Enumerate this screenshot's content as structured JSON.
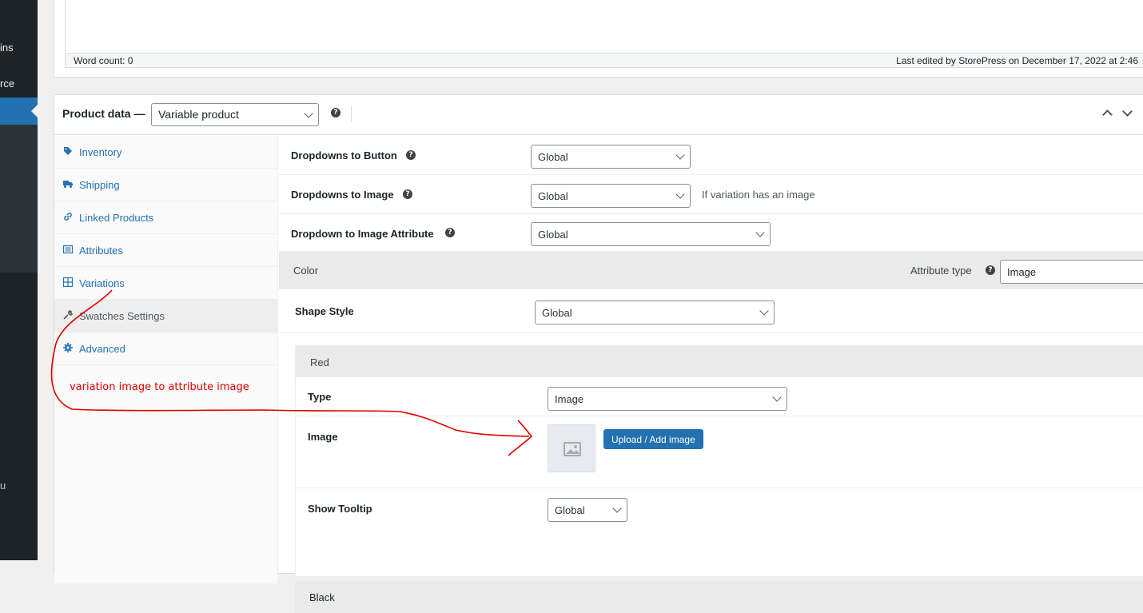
{
  "admin_menu": {
    "items": [
      "ins",
      "rce",
      "u"
    ]
  },
  "editor": {
    "word_count": "Word count: 0",
    "last_edited": "Last edited by StorePress on December 17, 2022 at 2:46"
  },
  "product_data": {
    "label": "Product data —",
    "type_value": "Variable product",
    "tabs": [
      {
        "label": "Inventory",
        "icon": "tag-icon"
      },
      {
        "label": "Shipping",
        "icon": "truck-icon"
      },
      {
        "label": "Linked Products",
        "icon": "link-icon"
      },
      {
        "label": "Attributes",
        "icon": "list-icon"
      },
      {
        "label": "Variations",
        "icon": "grid-icon"
      },
      {
        "label": "Swatches Settings",
        "icon": "wrench-icon"
      },
      {
        "label": "Advanced",
        "icon": "gear-icon"
      }
    ],
    "active_tab": "Swatches Settings"
  },
  "settings": {
    "dropdowns_to_button": {
      "label": "Dropdowns to Button",
      "value": "Global"
    },
    "dropdowns_to_image": {
      "label": "Dropdowns to Image",
      "value": "Global",
      "note": "If variation has an image"
    },
    "dropdown_to_image_attribute": {
      "label": "Dropdown to Image Attribute",
      "value": "Global"
    }
  },
  "attribute": {
    "name": "Color",
    "type_label": "Attribute type",
    "type_value": "Image",
    "shape_style_label": "Shape Style",
    "shape_style_value": "Global"
  },
  "term": {
    "name": "Red",
    "type_label": "Type",
    "type_value": "Image",
    "image_label": "Image",
    "upload_button": "Upload / Add image",
    "tooltip_label": "Show Tooltip",
    "tooltip_value": "Global"
  },
  "next_term": {
    "name": "Black"
  },
  "annotation": {
    "text": "variation image to attribute image",
    "color": "#e00000"
  },
  "colors": {
    "accent": "#2271b1",
    "sidebar": "#1d2327",
    "annotation": "#e00000"
  }
}
